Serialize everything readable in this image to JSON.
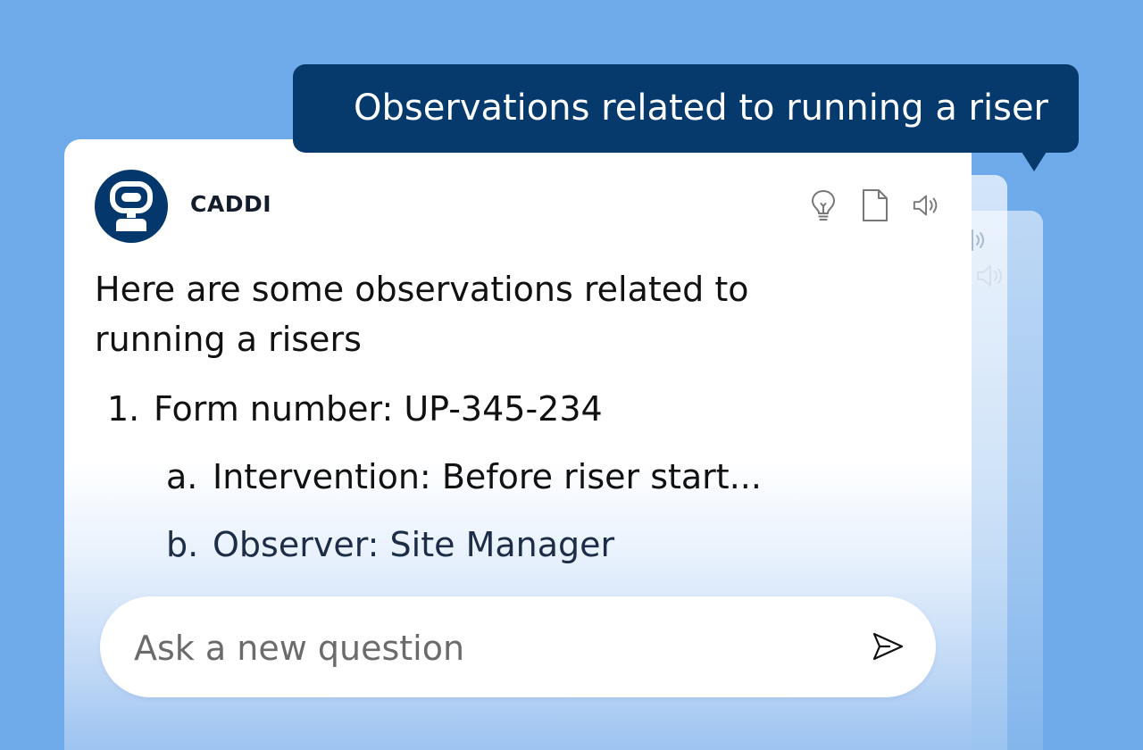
{
  "query_bubble": {
    "text": "Observations related to running a riser"
  },
  "chat_card": {
    "bot_name": "CADDI",
    "actions": {
      "idea_icon": "lightbulb-icon",
      "document_icon": "document-icon",
      "speaker_icon": "speaker-icon"
    },
    "intro": "Here are some observations related to running a risers",
    "list": {
      "item_1_marker": "1.",
      "item_1_text": "Form number: UP-345-234",
      "sub_a_marker": "a.",
      "sub_a_text": "Intervention: Before riser start...",
      "sub_b_marker": "b.",
      "sub_b_text": "Observer: Site Manager"
    }
  },
  "input": {
    "placeholder": "Ask a new question",
    "value": ""
  },
  "colors": {
    "background": "#6ea9e9",
    "bubble": "#063a6d",
    "avatar": "#04376b",
    "card": "#ffffff"
  }
}
